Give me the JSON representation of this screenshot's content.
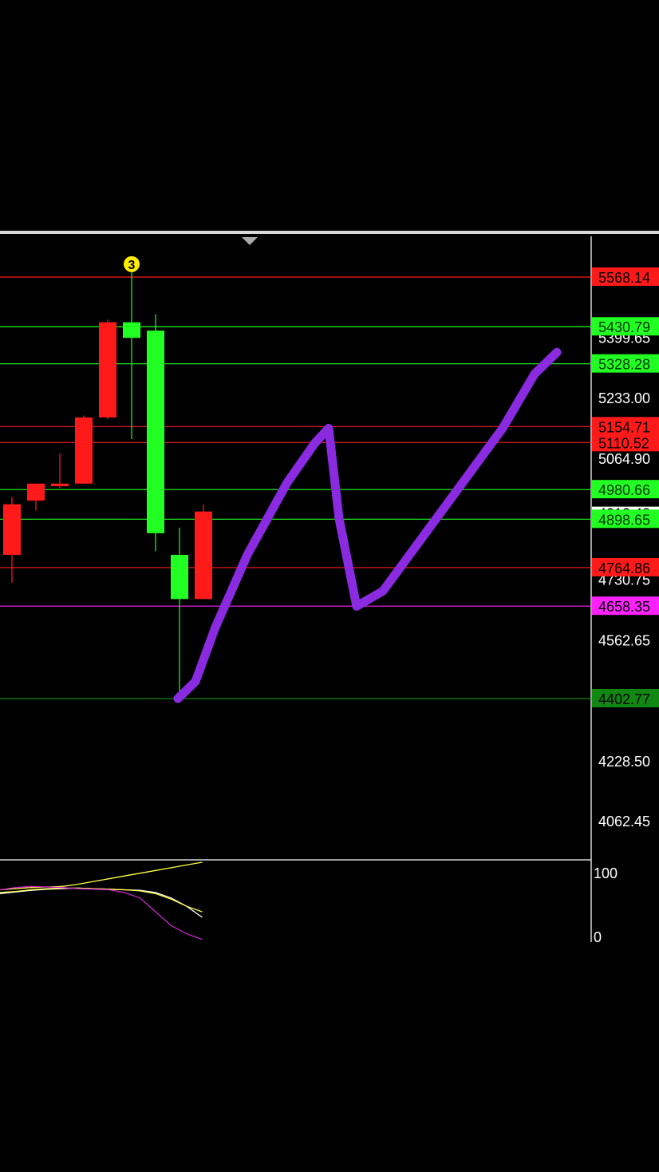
{
  "chart_data": {
    "type": "candlestick",
    "price_axis": {
      "ticks": [
        "5233.00",
        "5064.90",
        "4562.65",
        "4228.50",
        "4062.45"
      ],
      "partial_ticks": [
        "5399.65",
        "4913.48",
        "4730.75"
      ]
    },
    "indicator_axis": {
      "ticks": [
        "100",
        "0"
      ]
    },
    "marker_label": "3",
    "candles": [
      {
        "open": 4800,
        "high": 4960,
        "low": 4723,
        "close": 4940,
        "color": "red"
      },
      {
        "open": 4950,
        "high": 4980,
        "low": 4923,
        "close": 4997,
        "color": "red"
      },
      {
        "open": 4990,
        "high": 5080,
        "low": 4985,
        "close": 4997,
        "color": "red"
      },
      {
        "open": 4997,
        "high": 5185,
        "low": 4997,
        "close": 5180,
        "color": "red"
      },
      {
        "open": 5180,
        "high": 5450,
        "low": 5175,
        "close": 5443,
        "color": "red"
      },
      {
        "open": 5443,
        "high": 5595,
        "low": 5120,
        "close": 5400,
        "color": "green"
      },
      {
        "open": 5420,
        "high": 5465,
        "low": 4810,
        "close": 4860,
        "color": "green"
      },
      {
        "open": 4800,
        "high": 4875,
        "low": 4420,
        "close": 4678,
        "color": "green"
      },
      {
        "open": 4678,
        "high": 4940,
        "low": 4678,
        "close": 4920,
        "color": "red"
      }
    ],
    "levels": [
      {
        "value": 5568.14,
        "label": "5568.14",
        "color": "#ff1a1a"
      },
      {
        "value": 5430.79,
        "label": "5430.79",
        "color": "#22ff22"
      },
      {
        "value": 5328.28,
        "label": "5328.28",
        "color": "#22ff22"
      },
      {
        "value": 5154.71,
        "label": "5154.71",
        "color": "#ff1a1a"
      },
      {
        "value": 5110.52,
        "label": "5110.52",
        "color": "#ff1a1a"
      },
      {
        "value": 4980.66,
        "label": "4980.66",
        "color": "#22ff22"
      },
      {
        "value": 4898.65,
        "label": "4898.65",
        "color": "#22ff22"
      },
      {
        "value": 4764.86,
        "label": "4764.86",
        "color": "#ff1a1a"
      },
      {
        "value": 4658.35,
        "label": "4658.35",
        "color": "#ff22ff"
      },
      {
        "value": 4402.77,
        "label": "4402.77",
        "color": "#118811"
      }
    ],
    "current_price": {
      "value": 4913.48,
      "label": "4913.48"
    },
    "drawn_path_prices": [
      4402.77,
      4450,
      4600,
      4800,
      5000,
      5110,
      5150,
      4900,
      4658,
      4700,
      4850,
      5000,
      5150,
      5300,
      5360
    ],
    "indicator_series": [
      {
        "name": "",
        "color": "#ffff44",
        "values": [
          95,
          97,
          99,
          100,
          101,
          105,
          110,
          115,
          120,
          125,
          130,
          135,
          140,
          145
        ]
      },
      {
        "name": "",
        "color": "#ffffff",
        "values": [
          88,
          91,
          94,
          96,
          97,
          98,
          97,
          96,
          95,
          94,
          90,
          80,
          65,
          45
        ]
      },
      {
        "name": "",
        "color": "#ffff44",
        "values": [
          90,
          92,
          95,
          97,
          98,
          98,
          97,
          96,
          95,
          93,
          88,
          78,
          65,
          55
        ]
      },
      {
        "name": "",
        "color": "#cc22cc",
        "values": [
          95,
          99,
          101,
          100,
          99,
          97,
          96,
          95,
          90,
          80,
          55,
          30,
          15,
          5
        ]
      }
    ],
    "colors": {
      "bull": "#22ff22",
      "bear": "#ff1a1a",
      "drawn_path": "#8a2be2",
      "marker": "#ffee00"
    }
  }
}
